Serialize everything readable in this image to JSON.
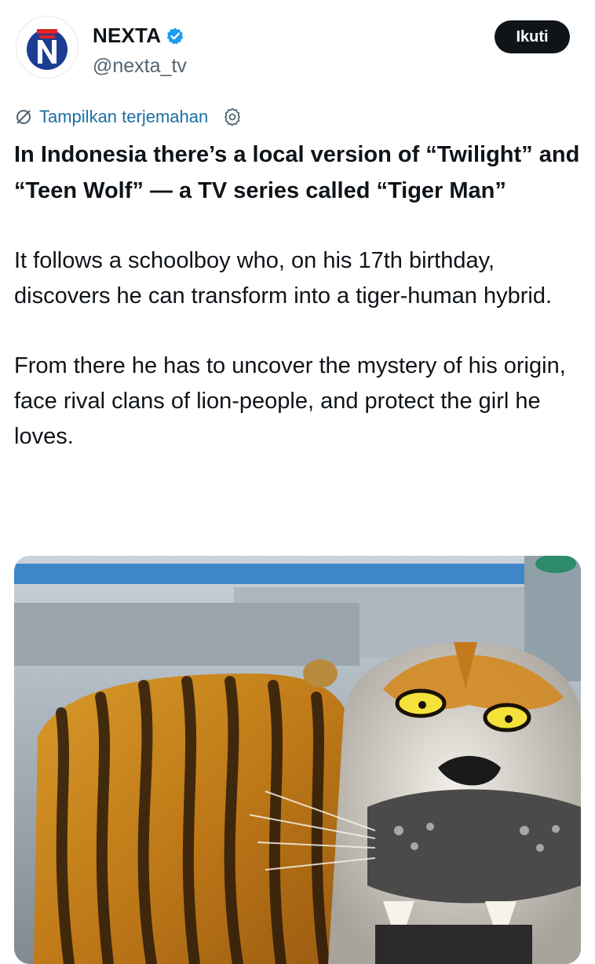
{
  "author": {
    "name": "NEXTA",
    "handle": "@nexta_tv",
    "verified": true,
    "avatar_icon": "nexta-logo-icon"
  },
  "follow_button": {
    "label": "Ikuti"
  },
  "translate": {
    "label": "Tampilkan terjemahan",
    "icon": "translate-link-icon",
    "settings_icon": "settings-icon"
  },
  "post": {
    "title": "In Indonesia there’s a local version of “Twilight” and “Teen Wolf” — a TV series called “Tiger Man”",
    "paragraphs": [
      "It follows a schoolboy who, on his 17th birthday, discovers he can transform into a tiger-human hybrid.",
      "From there he has to uncover the mystery of his origin, face rival clans of lion-people, and protect the girl he loves."
    ]
  },
  "media": {
    "type": "video-thumbnail"
  },
  "colors": {
    "text": "#0f1419",
    "secondary": "#536471",
    "link": "#1d6fa5",
    "verified": "#1d9bf0",
    "follow_bg": "#0f1419",
    "nexta_red": "#e0242a",
    "nexta_blue": "#1b3e94"
  }
}
